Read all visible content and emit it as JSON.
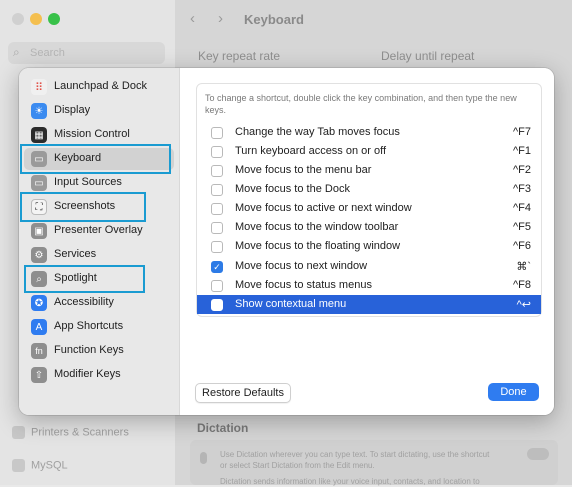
{
  "background": {
    "search_placeholder": "Search",
    "window_title": "Keyboard",
    "key_repeat_label": "Key repeat rate",
    "delay_label": "Delay until repeat",
    "printers_label": "Printers & Scanners",
    "mysql_label": "MySQL",
    "dictation_header": "Dictation",
    "dictation_text_1": "Use Dictation wherever you can type text. To start dictating, use the shortcut",
    "dictation_text_2": "or select Start Dictation from the Edit menu.",
    "dictation_text_3": "Dictation sends information like your voice input, contacts, and location to"
  },
  "colors": {
    "accent": "#2f7cf0",
    "selection": "#2862d9",
    "highlight_box": "#1a9bd1"
  },
  "sidebar": {
    "items": [
      {
        "label": "Launchpad & Dock",
        "icon": "launchpad-icon"
      },
      {
        "label": "Display",
        "icon": "display-icon"
      },
      {
        "label": "Mission Control",
        "icon": "mission-control-icon"
      },
      {
        "label": "Keyboard",
        "icon": "keyboard-icon"
      },
      {
        "label": "Input Sources",
        "icon": "input-sources-icon"
      },
      {
        "label": "Screenshots",
        "icon": "screenshot-icon"
      },
      {
        "label": "Presenter Overlay",
        "icon": "presenter-overlay-icon"
      },
      {
        "label": "Services",
        "icon": "gear-icon"
      },
      {
        "label": "Spotlight",
        "icon": "spotlight-icon"
      },
      {
        "label": "Accessibility",
        "icon": "accessibility-icon"
      },
      {
        "label": "App Shortcuts",
        "icon": "app-shortcuts-icon"
      },
      {
        "label": "Function Keys",
        "icon": "function-keys-icon"
      },
      {
        "label": "Modifier Keys",
        "icon": "modifier-keys-icon"
      }
    ],
    "selected": "Keyboard"
  },
  "main": {
    "instructions": "To change a shortcut, double click the key combination, and then type the new keys.",
    "shortcuts": [
      {
        "label": "Change the way Tab moves focus",
        "key": "^F7",
        "checked": false
      },
      {
        "label": "Turn keyboard access on or off",
        "key": "^F1",
        "checked": false
      },
      {
        "label": "Move focus to the menu bar",
        "key": "^F2",
        "checked": false
      },
      {
        "label": "Move focus to the Dock",
        "key": "^F3",
        "checked": false
      },
      {
        "label": "Move focus to active or next window",
        "key": "^F4",
        "checked": false
      },
      {
        "label": "Move focus to the window toolbar",
        "key": "^F5",
        "checked": false
      },
      {
        "label": "Move focus to the floating window",
        "key": "^F6",
        "checked": false
      },
      {
        "label": "Move focus to next window",
        "key": "⌘`",
        "checked": true
      },
      {
        "label": "Move focus to status menus",
        "key": "^F8",
        "checked": false
      },
      {
        "label": "Show contextual menu",
        "key": "^↩",
        "checked": false,
        "selected": true
      }
    ]
  },
  "buttons": {
    "restore": "Restore Defaults",
    "done": "Done"
  }
}
